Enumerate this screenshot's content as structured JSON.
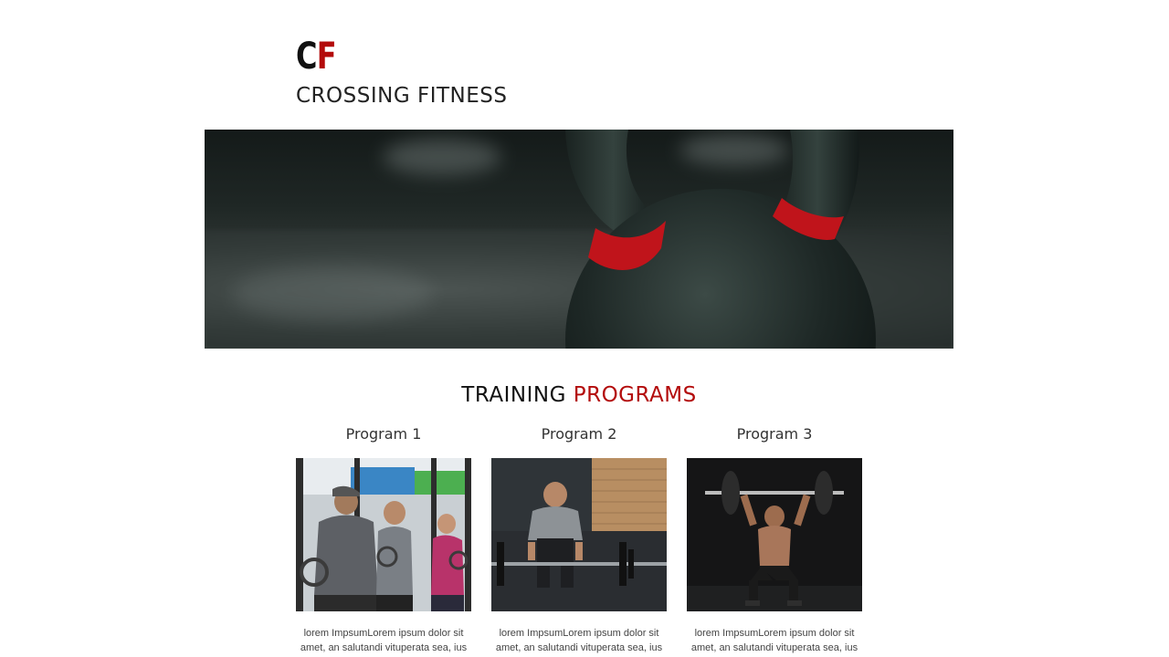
{
  "brand": {
    "logo_letters": [
      "C",
      "F"
    ],
    "name": "CROSSING FITNESS",
    "accent_color": "#b30b0b"
  },
  "hero": {
    "image_name": "kettlebell-hero-image"
  },
  "section": {
    "title_part1": "TRAINING ",
    "title_part2": "PROGRAMS"
  },
  "programs": [
    {
      "title": "Program 1",
      "image": "group-ring-training-photo",
      "text": "lorem ImpsumLorem ipsum dolor sit amet, an salutandi vituperata sea, ius"
    },
    {
      "title": "Program 2",
      "image": "deadlift-training-photo",
      "text": "lorem ImpsumLorem ipsum dolor sit amet, an salutandi vituperata sea, ius"
    },
    {
      "title": "Program 3",
      "image": "overhead-squat-photo",
      "text": "lorem ImpsumLorem ipsum dolor sit amet, an salutandi vituperata sea, ius"
    }
  ]
}
